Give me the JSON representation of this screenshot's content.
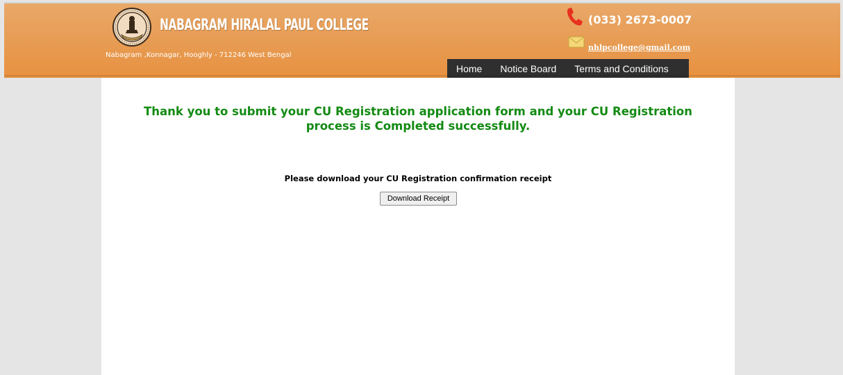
{
  "header": {
    "college_name": "NABAGRAM HIRALAL PAUL COLLEGE",
    "address": "Nabagram ,Konnagar, Hooghly - 712246 West Bengal",
    "phone": "(033) 2673-0007",
    "email": "nhlpcollege@gmail.com",
    "phone_icon": "phone-icon",
    "mail_icon": "mail-icon",
    "colors": {
      "header_orange": "#e79a50",
      "nav_bg": "#2f2f2f",
      "success_green": "#138a13"
    }
  },
  "nav": {
    "items": [
      {
        "label": "Home"
      },
      {
        "label": "Notice Board"
      },
      {
        "label": "Terms and Conditions"
      }
    ]
  },
  "main": {
    "message_line1": "Thank you to submit your CU Registration application form and your CU Registration",
    "message_line2": "process is Completed successfully.",
    "instruction": "Please download your CU Registration confirmation receipt",
    "download_button": "Download Receipt"
  }
}
